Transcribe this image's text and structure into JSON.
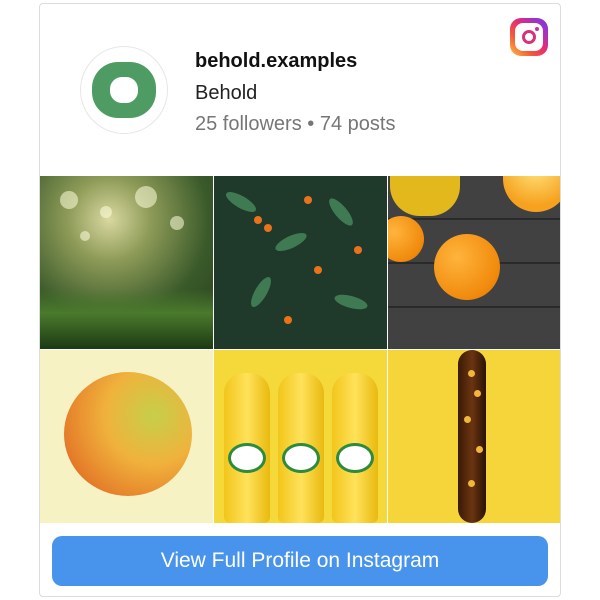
{
  "profile": {
    "username": "behold.examples",
    "name": "Behold",
    "stats": "25 followers • 74 posts",
    "avatar_color": "#4e9c63"
  },
  "icons": {
    "instagram": "instagram-icon"
  },
  "posts": [
    {
      "id": 1,
      "description": "grass with dew drops"
    },
    {
      "id": 2,
      "description": "orange berries and leaves"
    },
    {
      "id": 3,
      "description": "oranges and juice on wood"
    },
    {
      "id": 4,
      "description": "grapefruit"
    },
    {
      "id": 5,
      "description": "jarritos bottles"
    },
    {
      "id": 6,
      "description": "bubbling liquid on yellow"
    }
  ],
  "cta": {
    "label": "View Full Profile on Instagram",
    "color": "#4893ec"
  }
}
